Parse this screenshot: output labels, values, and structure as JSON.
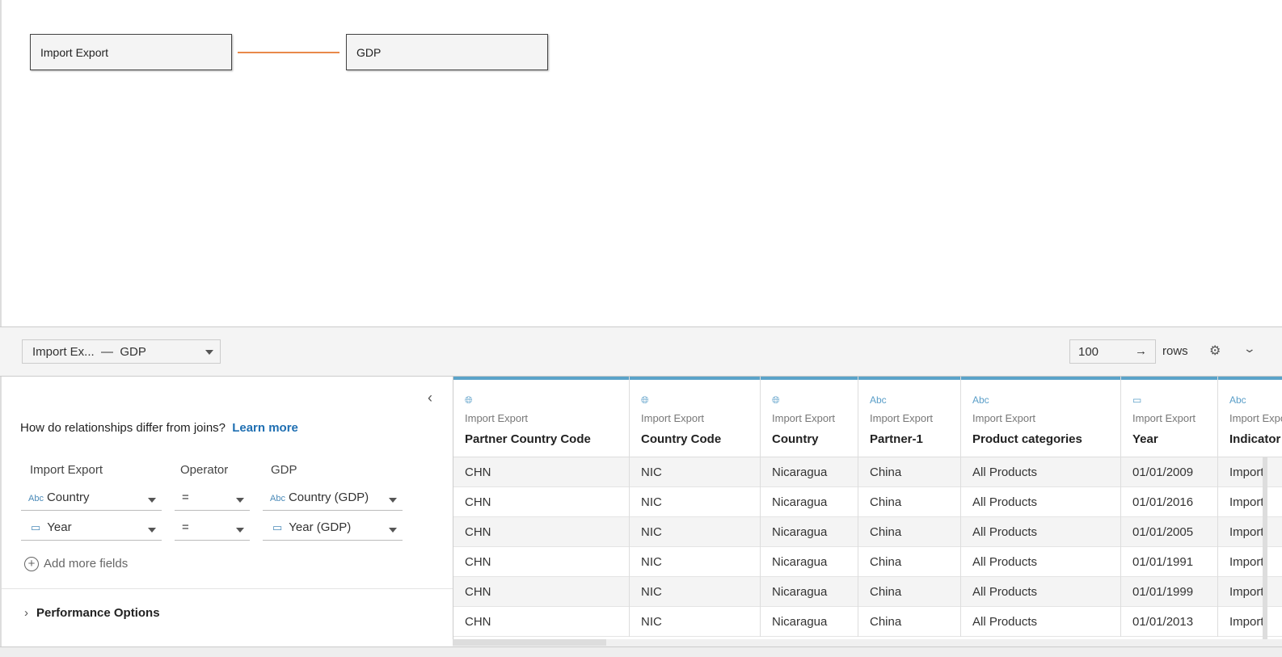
{
  "canvas": {
    "left_table": "Import Export",
    "right_table": "GDP",
    "link_color": "#e8894a"
  },
  "toolbar": {
    "relationship": "Import Ex...  —  GDP",
    "rows_value": "100",
    "rows_label": "rows"
  },
  "panel": {
    "question": "How do relationships differ from joins?",
    "learn_more": "Learn more",
    "headers": {
      "left": "Import Export",
      "op": "Operator",
      "right": "GDP"
    },
    "clauses": [
      {
        "left_type": "Abc",
        "left": "Country",
        "op": "=",
        "right_type": "Abc",
        "right": "Country (GDP)"
      },
      {
        "left_type": "date",
        "left": "Year",
        "op": "=",
        "right_type": "date",
        "right": "Year (GDP)"
      }
    ],
    "add_more": "Add more fields",
    "performance": "Performance Options"
  },
  "grid": {
    "columns": [
      {
        "type": "globe",
        "source": "Import Export",
        "name": "Partner Country Code",
        "values": [
          "CHN",
          "CHN",
          "CHN",
          "CHN",
          "CHN",
          "CHN"
        ]
      },
      {
        "type": "globe",
        "source": "Import Export",
        "name": "Country Code",
        "values": [
          "NIC",
          "NIC",
          "NIC",
          "NIC",
          "NIC",
          "NIC"
        ]
      },
      {
        "type": "globe",
        "source": "Import Export",
        "name": "Country",
        "values": [
          "Nicaragua",
          "Nicaragua",
          "Nicaragua",
          "Nicaragua",
          "Nicaragua",
          "Nicaragua"
        ]
      },
      {
        "type": "Abc",
        "source": "Import Export",
        "name": "Partner-1",
        "values": [
          "China",
          "China",
          "China",
          "China",
          "China",
          "China"
        ]
      },
      {
        "type": "Abc",
        "source": "Import Export",
        "name": "Product categories",
        "values": [
          "All Products",
          "All Products",
          "All Products",
          "All Products",
          "All Products",
          "All Products"
        ]
      },
      {
        "type": "date",
        "source": "Import Export",
        "name": "Year",
        "values": [
          "01/01/2009",
          "01/01/2016",
          "01/01/2005",
          "01/01/1991",
          "01/01/1999",
          "01/01/2013"
        ]
      },
      {
        "type": "Abc",
        "source": "Import Export",
        "name": "Indicator",
        "values": [
          "Import",
          "Import",
          "Import",
          "Import",
          "Import",
          "Import"
        ]
      }
    ]
  }
}
